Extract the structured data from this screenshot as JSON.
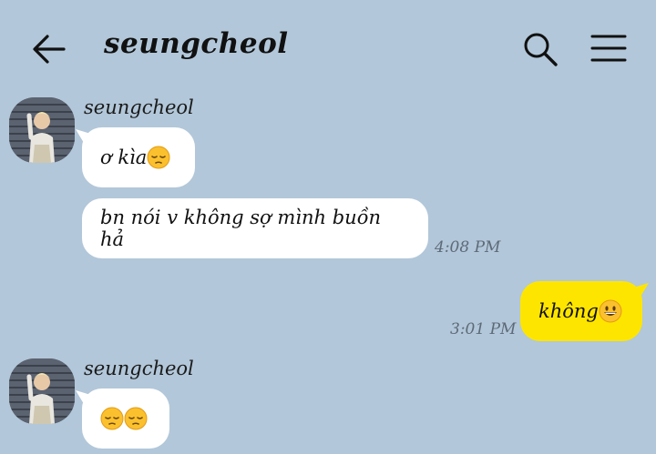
{
  "header": {
    "title": "seungcheol",
    "back_icon": "arrow-left-icon",
    "search_icon": "search-icon",
    "menu_icon": "hamburger-menu-icon"
  },
  "messages": [
    {
      "sender": "seungcheol",
      "text": "ơ kìa",
      "emoji": "pensive-face",
      "time": ""
    },
    {
      "sender": "seungcheol",
      "text": "bn nói v không sợ mình buồn hả",
      "time": "4:08 PM"
    },
    {
      "sender": "me",
      "text": "không",
      "emoji": "grinning-face",
      "time": "3:01 PM"
    },
    {
      "sender": "seungcheol",
      "text": "",
      "emoji": "pensive-face pensive-face",
      "time": ""
    }
  ],
  "colors": {
    "background": "#b2c7d9",
    "incoming_bubble": "#ffffff",
    "outgoing_bubble": "#fee500",
    "timestamp": "#5d6a78"
  }
}
